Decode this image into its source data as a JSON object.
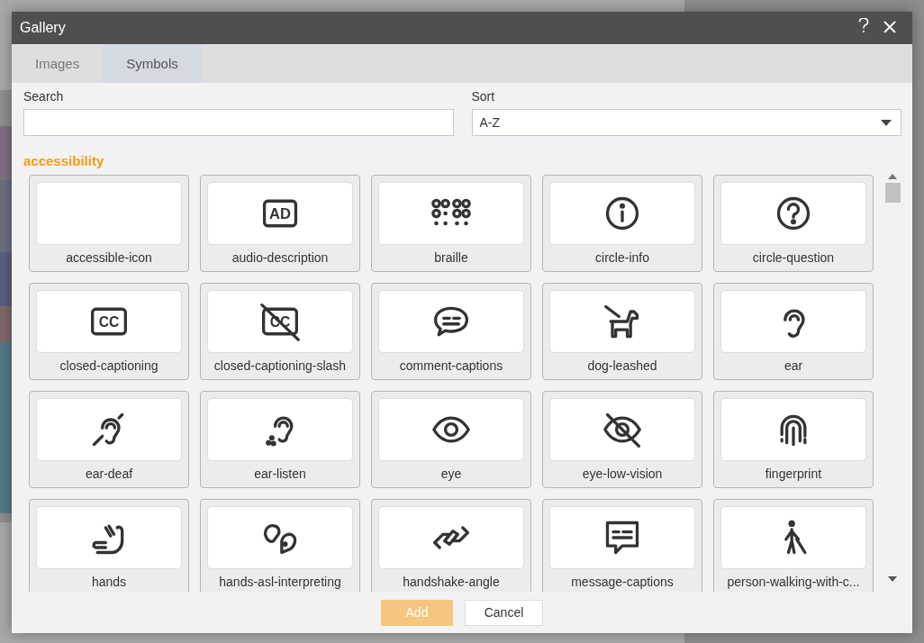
{
  "window": {
    "title": "Gallery"
  },
  "tabs": [
    {
      "label": "Images",
      "selected": false
    },
    {
      "label": "Symbols",
      "selected": true
    }
  ],
  "search": {
    "label": "Search"
  },
  "sort": {
    "label": "Sort",
    "value": "A-Z"
  },
  "category": "accessibility",
  "symbols": [
    {
      "name": "accessible-icon"
    },
    {
      "name": "audio-description",
      "icon_text": "AD"
    },
    {
      "name": "braille"
    },
    {
      "name": "circle-info"
    },
    {
      "name": "circle-question"
    },
    {
      "name": "closed-captioning",
      "icon_text": "CC"
    },
    {
      "name": "closed-captioning-slash",
      "icon_text": "CC"
    },
    {
      "name": "comment-captions"
    },
    {
      "name": "dog-leashed"
    },
    {
      "name": "ear"
    },
    {
      "name": "ear-deaf"
    },
    {
      "name": "ear-listen"
    },
    {
      "name": "eye"
    },
    {
      "name": "eye-low-vision"
    },
    {
      "name": "fingerprint"
    },
    {
      "name": "hands"
    },
    {
      "name": "hands-asl-interpreting"
    },
    {
      "name": "handshake-angle"
    },
    {
      "name": "message-captions"
    },
    {
      "name": "person-walking-with-c..."
    }
  ],
  "buttons": {
    "add": "Add",
    "cancel": "Cancel"
  }
}
